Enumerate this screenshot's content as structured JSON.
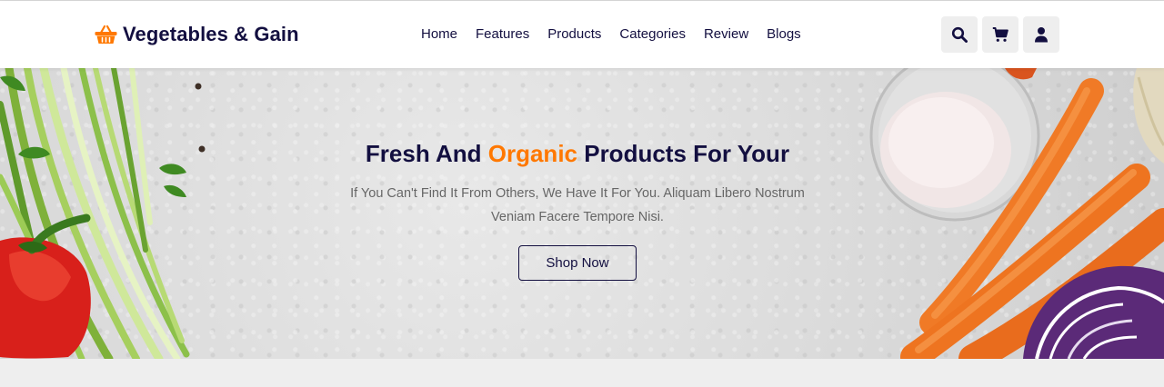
{
  "brand": {
    "name": "Vegetables & Gain",
    "accent_color": "#ff7800",
    "primary_color": "#130f40",
    "icon": "basket-icon"
  },
  "nav": {
    "items": [
      {
        "label": "Home"
      },
      {
        "label": "Features"
      },
      {
        "label": "Products"
      },
      {
        "label": "Categories"
      },
      {
        "label": "Review"
      },
      {
        "label": "Blogs"
      }
    ]
  },
  "header_icons": [
    {
      "icon": "search-icon"
    },
    {
      "icon": "shopping-cart-icon"
    },
    {
      "icon": "user-icon"
    }
  ],
  "hero": {
    "title_start": "Fresh And ",
    "title_accent": "Organic",
    "title_end": " Products For Your",
    "subtitle": "If You Can't Find It From Others, We Have It For You. Aliquam Libero Nostrum Veniam Facere Tempore Nisi.",
    "cta_label": "Shop Now"
  }
}
